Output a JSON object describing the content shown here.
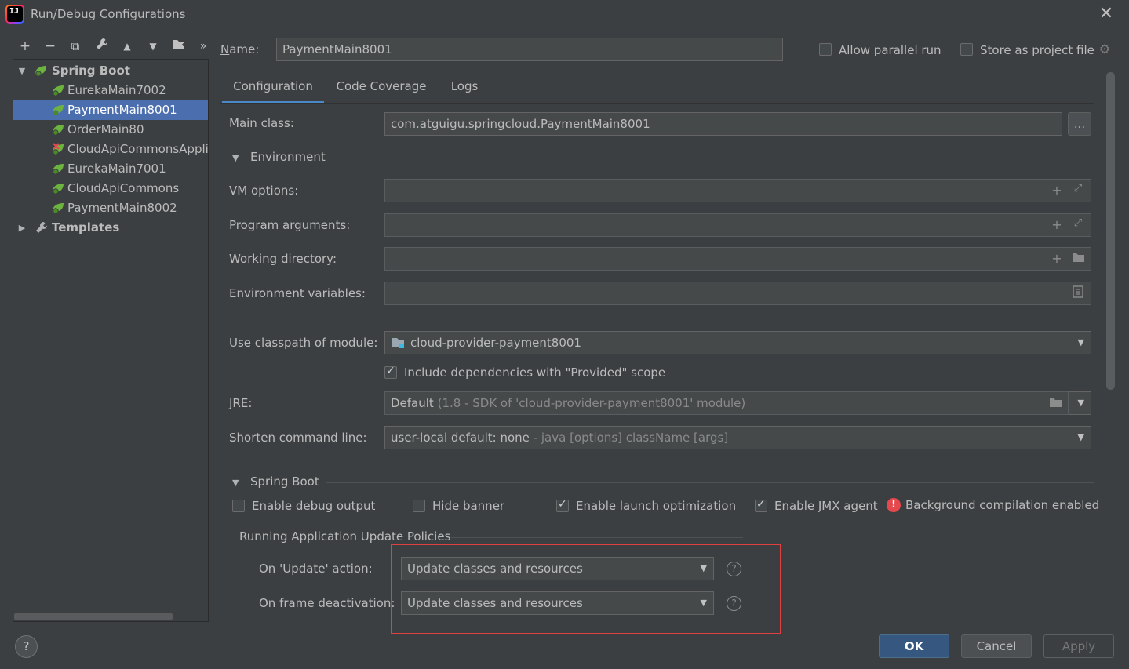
{
  "window": {
    "title": "Run/Debug Configurations"
  },
  "toolbar": {
    "add": "+",
    "remove": "−",
    "copy": "⧉",
    "wrench": "🔧",
    "up": "▲",
    "down": "▼",
    "folder": "📁",
    "more": "»"
  },
  "tree": {
    "root": "Spring Boot",
    "items": [
      {
        "label": "EurekaMain7002",
        "status": "ok"
      },
      {
        "label": "PaymentMain8001",
        "status": "ok",
        "selected": true
      },
      {
        "label": "OrderMain80",
        "status": "ok"
      },
      {
        "label": "CloudApiCommonsAppli",
        "status": "error"
      },
      {
        "label": "EurekaMain7001",
        "status": "ok"
      },
      {
        "label": "CloudApiCommons",
        "status": "ok"
      },
      {
        "label": "PaymentMain8002",
        "status": "ok"
      }
    ],
    "templates": "Templates"
  },
  "header": {
    "name_label": "Name:",
    "name_value": "PaymentMain8001",
    "allow_parallel": "Allow parallel run",
    "store_project": "Store as project file"
  },
  "tabs": [
    "Configuration",
    "Code Coverage",
    "Logs"
  ],
  "form": {
    "main_class_label": "Main class:",
    "main_class_value": "com.atguigu.springcloud.PaymentMain8001",
    "browse": "...",
    "environment_section": "Environment",
    "vm_options_label": "VM options:",
    "program_args_label": "Program arguments:",
    "working_dir_label": "Working directory:",
    "env_vars_label": "Environment variables:",
    "classpath_label": "Use classpath of module:",
    "classpath_value": "cloud-provider-payment8001",
    "include_deps": "Include dependencies with \"Provided\" scope",
    "jre_label": "JRE:",
    "jre_value": "Default",
    "jre_hint": "(1.8 - SDK of 'cloud-provider-payment8001' module)",
    "shorten_label": "Shorten command line:",
    "shorten_value": "user-local default: none",
    "shorten_hint": "- java [options] className [args]"
  },
  "spring_boot": {
    "section": "Spring Boot",
    "enable_debug": "Enable debug output",
    "hide_banner": "Hide banner",
    "launch_opt": "Enable launch optimization",
    "jmx_agent": "Enable JMX agent",
    "bg_compilation": "Background compilation enabled",
    "policies_title": "Running Application Update Policies",
    "on_update_label": "On 'Update' action:",
    "on_update_value": "Update classes and resources",
    "on_frame_label": "On frame deactivation:",
    "on_frame_value": "Update classes and resources"
  },
  "buttons": {
    "ok": "OK",
    "cancel": "Cancel",
    "apply": "Apply",
    "help": "?"
  },
  "colors": {
    "accent": "#4a88c7",
    "selection": "#4b6eaf",
    "highlight_box": "#e04040",
    "error": "#e5484d"
  }
}
